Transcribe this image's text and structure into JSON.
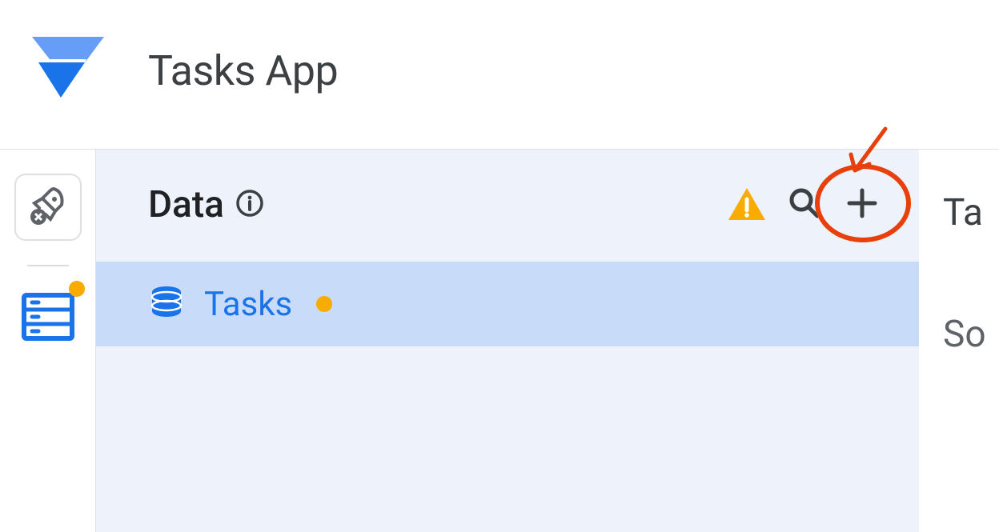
{
  "app": {
    "title": "Tasks App"
  },
  "panel": {
    "title": "Data",
    "source": {
      "label": "Tasks"
    }
  },
  "rightEdge": {
    "top": "Ta",
    "mid": "So"
  }
}
